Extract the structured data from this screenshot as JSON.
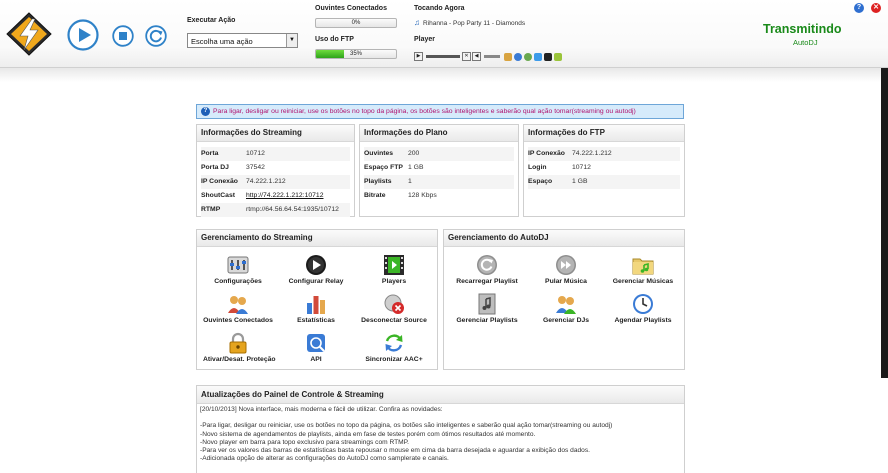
{
  "header": {
    "executar_label": "Executar Ação",
    "action_select_value": "Escolha uma ação",
    "ouvintes_label": "Ouvintes Conectados",
    "ouvintes_percent": 0,
    "ouvintes_text": "0%",
    "ftp_label": "Uso do FTP",
    "ftp_percent": 35,
    "ftp_text": "35%",
    "tocando_label": "Tocando Agora",
    "now_playing": "Rihanna - Pop Party 11 - Diamonds",
    "player_label": "Player",
    "status_title": "Transmitindo",
    "status_sub": "AutoDJ"
  },
  "banner": {
    "text": "Para ligar, desligar ou reiniciar, use os botões no topo da página, os botões são inteligentes e saberão qual ação tomar(streaming ou autodj)"
  },
  "streaming_info": {
    "title": "Informações do Streaming",
    "rows": [
      {
        "k": "Porta",
        "v": "10712"
      },
      {
        "k": "Porta DJ",
        "v": "37542"
      },
      {
        "k": "IP Conexão",
        "v": "74.222.1.212"
      },
      {
        "k": "ShoutCast",
        "v": "http://74.222.1.212:10712"
      },
      {
        "k": "RTMP",
        "v": "rtmp://64.56.64.54:1935/10712"
      }
    ]
  },
  "plano_info": {
    "title": "Informações do Plano",
    "rows": [
      {
        "k": "Ouvintes",
        "v": "200"
      },
      {
        "k": "Espaço FTP",
        "v": "1 GB"
      },
      {
        "k": "Playlists",
        "v": "1"
      },
      {
        "k": "Bitrate",
        "v": "128 Kbps"
      }
    ]
  },
  "ftp_info": {
    "title": "Informações do FTP",
    "rows": [
      {
        "k": "IP Conexão",
        "v": "74.222.1.212"
      },
      {
        "k": "Login",
        "v": "10712"
      },
      {
        "k": "Espaço",
        "v": "1 GB"
      }
    ]
  },
  "ger_streaming": {
    "title": "Gerenciamento do Streaming",
    "items": [
      {
        "label": "Configurações"
      },
      {
        "label": "Configurar Relay"
      },
      {
        "label": "Players"
      },
      {
        "label": "Ouvintes Conectados"
      },
      {
        "label": "Estatísticas"
      },
      {
        "label": "Desconectar Source"
      },
      {
        "label": "Ativar/Desat. Proteção"
      },
      {
        "label": "API"
      },
      {
        "label": "Sincronizar AAC+"
      }
    ]
  },
  "ger_autodj": {
    "title": "Gerenciamento do AutoDJ",
    "items": [
      {
        "label": "Recarregar Playlist"
      },
      {
        "label": "Pular Música"
      },
      {
        "label": "Gerenciar Músicas"
      },
      {
        "label": "Gerenciar Playlists"
      },
      {
        "label": "Gerenciar DJs"
      },
      {
        "label": "Agendar Playlists"
      }
    ]
  },
  "updates": {
    "title": "Atualizações do Painel de Controle & Streaming",
    "lines": [
      "[20/10/2013] Nova interface, mais moderna e fácil de utilizar. Confira as novidades:",
      "",
      "-Para ligar, desligar ou reiniciar, use os botões no topo da página, os botões são inteligentes e saberão qual ação tomar(streaming ou autodj)",
      "-Novo sistema de agendamentos de playlists, ainda em fase de testes porém com ótimos resultados até momento.",
      "-Novo player em barra para topo exclusivo para streamings com RTMP.",
      "-Para ver os valores das barras de estatísticas basta repousar o mouse em cima da barra desejada e aguardar a exibição dos dados.",
      "-Adicionada opção de alterar as configurações do AutoDJ como samplerate e canais."
    ]
  },
  "colors": {
    "status_green": "#1a8a1a",
    "banner_text": "#b0126e",
    "bar_green": "#3bb526"
  }
}
